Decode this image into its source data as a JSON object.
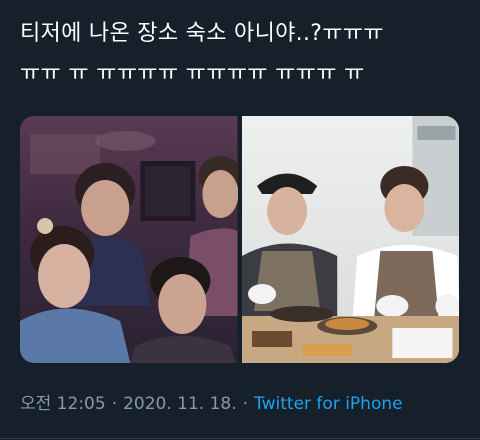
{
  "tweet": {
    "text_line1": "티저에 나온 장소 숙소 아니야..?ㅠㅠㅠ",
    "text_line2": "ㅠㅠ ㅠ ㅠㅠㅠㅠ ㅠㅠㅠㅠ ㅠㅠㅠ ㅠ",
    "time": "오전 12:05",
    "date": "2020. 11. 18.",
    "source": "Twitter for iPhone",
    "separator": "·"
  },
  "colors": {
    "background": "#15202b",
    "text": "#ffffff",
    "meta": "#8899a6",
    "link": "#1da1f2"
  }
}
